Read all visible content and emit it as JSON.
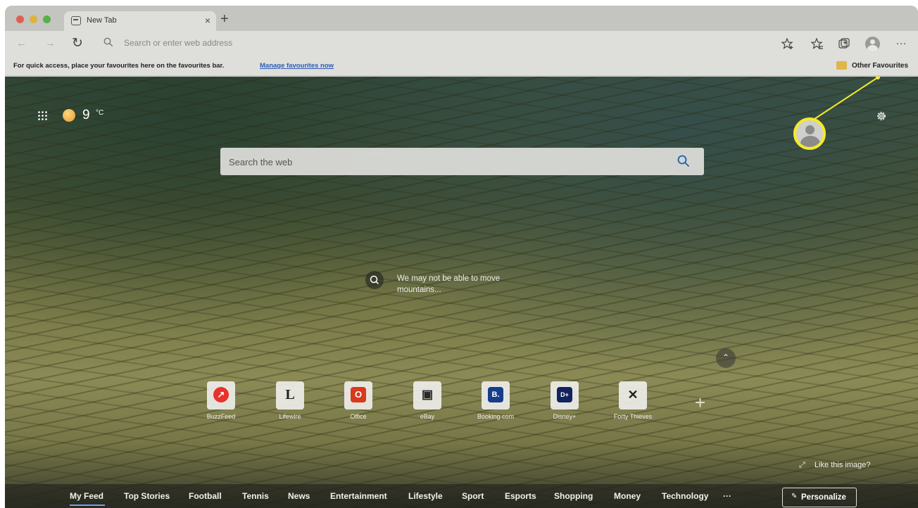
{
  "browser": {
    "tab": {
      "title": "New Tab",
      "close": "×"
    },
    "new_tab": "+",
    "toolbar": {
      "back": "←",
      "forward": "→",
      "reload": "↻",
      "address_placeholder": "Search or enter web address",
      "more": "···"
    },
    "favourites_bar": {
      "message": "For quick access, place your favourites here on the favourites bar.",
      "manage_link": "Manage favourites now",
      "other_favourites": "Other Favourites"
    }
  },
  "page": {
    "weather": {
      "temperature": "9",
      "unit": "°C"
    },
    "search": {
      "placeholder": "Search the web"
    },
    "image_caption": "We may not be able to move mountains...",
    "quick_links": [
      {
        "label": "BuzzFeed",
        "glyph": "↗",
        "color": "#e8322a"
      },
      {
        "label": "Lifewire",
        "glyph": "L",
        "color": "#222222"
      },
      {
        "label": "Office",
        "glyph": "O",
        "color": "#d9391c"
      },
      {
        "label": "eBay",
        "glyph": "▣",
        "color": "#2a2a2a"
      },
      {
        "label": "Booking.com",
        "glyph": "B.",
        "color": "#153d8a"
      },
      {
        "label": "Disney+",
        "glyph": "D+",
        "color": "#12225e"
      },
      {
        "label": "Forty Thieves",
        "glyph": "✕",
        "color": "#222222"
      }
    ],
    "add_link": "+",
    "collapse": "⌃",
    "like_image": {
      "icon": "⤢",
      "text": "Like this image?"
    },
    "feed_tabs": [
      "My Feed",
      "Top Stories",
      "Football",
      "Tennis",
      "News",
      "Entertainment",
      "Lifestyle",
      "Sport",
      "Esports",
      "Shopping",
      "Money",
      "Technology",
      "···"
    ],
    "personalize": {
      "icon": "✎",
      "label": "Personalize"
    }
  },
  "colors": {
    "highlight": "#f4ea2a",
    "link": "#2a5cb8",
    "active_feed_underline": "#6ea4f0"
  }
}
